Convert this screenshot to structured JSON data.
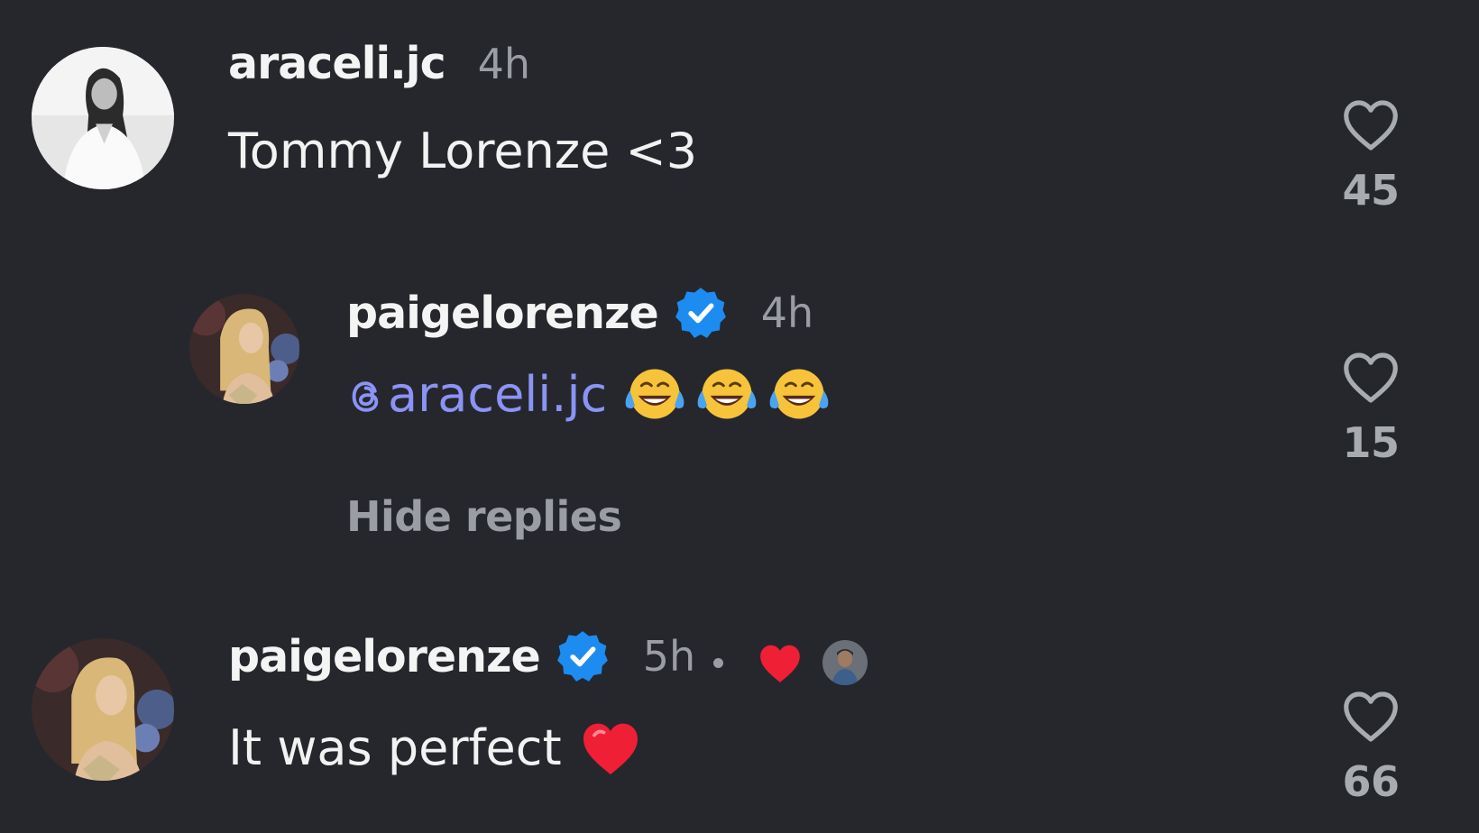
{
  "comments": [
    {
      "username": "araceli.jc",
      "time": "4h",
      "text": "Tommy Lorenze <3",
      "likes": "45",
      "verified": false,
      "avatar": "woman-in-white-bw"
    },
    {
      "username": "paigelorenze",
      "time": "4h",
      "mention": "araceli.jc",
      "emoji": [
        "face-with-tears-of-joy",
        "face-with-tears-of-joy",
        "face-with-tears-of-joy"
      ],
      "likes": "15",
      "verified": true,
      "is_reply": true,
      "avatar": "blonde-woman-profile",
      "hide_replies_label": "Hide replies"
    },
    {
      "username": "paigelorenze",
      "time": "5h",
      "text": "It was perfect",
      "trailing_emoji": "red-heart",
      "likes": "66",
      "verified": true,
      "liked_by_author": true,
      "avatar": "blonde-woman-profile"
    }
  ],
  "colors": {
    "background": "#25272d",
    "verified_badge": "#1d8cf0",
    "mention": "#8b93f5",
    "heart_red": "#ef1f35",
    "muted": "#9a9da3"
  },
  "icons": {
    "like": "heart-outline-icon",
    "verified": "verified-badge-icon",
    "mention": "threads-at-icon",
    "author_like": "red-heart-icon"
  }
}
